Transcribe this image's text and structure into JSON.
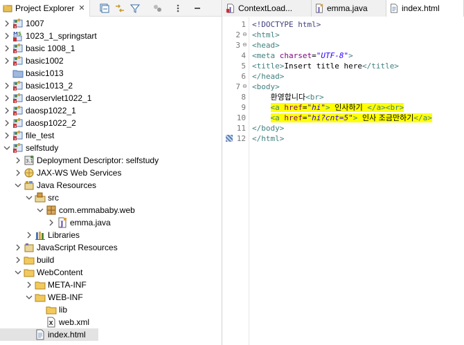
{
  "project_explorer": {
    "tab_label": "Project Explorer",
    "close_glyph": "✕",
    "toolbar": [
      "collapse-all-icon",
      "link-with-editor-icon",
      "filter-icon",
      "focus-icon",
      "view-menu-icon",
      "minimize-icon"
    ],
    "tree": [
      {
        "label": "1007",
        "icon": "web-project-icon",
        "depth": 0,
        "twisty": ">"
      },
      {
        "label": "1023_1_springstart",
        "icon": "maven-spring-project-icon",
        "depth": 0,
        "twisty": ">"
      },
      {
        "label": "basic 1008_1",
        "icon": "web-project-icon",
        "depth": 0,
        "twisty": ">"
      },
      {
        "label": "basic1002",
        "icon": "web-project-icon",
        "depth": 0,
        "twisty": ">"
      },
      {
        "label": "basic1013",
        "icon": "folder-project-icon",
        "depth": 0,
        "twisty": ""
      },
      {
        "label": "basic1013_2",
        "icon": "web-project-icon",
        "depth": 0,
        "twisty": ">"
      },
      {
        "label": "daoservlet1022_1",
        "icon": "web-project-icon",
        "depth": 0,
        "twisty": ">"
      },
      {
        "label": "daosp1022_1",
        "icon": "web-project-icon",
        "depth": 0,
        "twisty": ">"
      },
      {
        "label": "daosp1022_2",
        "icon": "web-project-icon",
        "depth": 0,
        "twisty": ">"
      },
      {
        "label": "file_test",
        "icon": "web-project-icon",
        "depth": 0,
        "twisty": ">"
      },
      {
        "label": "selfstudy",
        "icon": "web-project-icon",
        "depth": 0,
        "twisty": "v"
      },
      {
        "label": "Deployment Descriptor: selfstudy",
        "icon": "deployment-descriptor-icon",
        "depth": 1,
        "twisty": ">"
      },
      {
        "label": "JAX-WS Web Services",
        "icon": "web-services-icon",
        "depth": 1,
        "twisty": ">"
      },
      {
        "label": "Java Resources",
        "icon": "java-resources-icon",
        "depth": 1,
        "twisty": "v"
      },
      {
        "label": "src",
        "icon": "source-folder-icon",
        "depth": 2,
        "twisty": "v"
      },
      {
        "label": "com.emmababy.web",
        "icon": "package-icon",
        "depth": 3,
        "twisty": "v"
      },
      {
        "label": "emma.java",
        "icon": "java-file-icon",
        "depth": 4,
        "twisty": ">"
      },
      {
        "label": "Libraries",
        "icon": "libraries-icon",
        "depth": 2,
        "twisty": ">"
      },
      {
        "label": "JavaScript Resources",
        "icon": "javascript-resources-icon",
        "depth": 1,
        "twisty": ">"
      },
      {
        "label": "build",
        "icon": "folder-icon",
        "depth": 1,
        "twisty": ">"
      },
      {
        "label": "WebContent",
        "icon": "folder-icon",
        "depth": 1,
        "twisty": "v"
      },
      {
        "label": "META-INF",
        "icon": "folder-icon",
        "depth": 2,
        "twisty": ">"
      },
      {
        "label": "WEB-INF",
        "icon": "folder-icon",
        "depth": 2,
        "twisty": "v"
      },
      {
        "label": "lib",
        "icon": "folder-icon",
        "depth": 3,
        "twisty": ""
      },
      {
        "label": "web.xml",
        "icon": "xml-file-icon",
        "depth": 3,
        "twisty": ""
      },
      {
        "label": "index.html",
        "icon": "html-file-icon",
        "depth": 2,
        "twisty": "",
        "selected": true
      }
    ]
  },
  "editor": {
    "tabs": [
      {
        "label": "ContextLoad...",
        "icon": "java-class-icon",
        "active": false
      },
      {
        "label": "emma.java",
        "icon": "java-file-icon",
        "active": false
      },
      {
        "label": "index.html",
        "icon": "html-file-icon",
        "active": true
      }
    ],
    "lines": [
      {
        "n": "1",
        "fold": "",
        "highlight": false,
        "tokens": [
          [
            "doc",
            "<!DOCTYPE html>"
          ]
        ]
      },
      {
        "n": "2",
        "fold": "⊖",
        "highlight": false,
        "tokens": [
          [
            "tag",
            "<html>"
          ]
        ]
      },
      {
        "n": "3",
        "fold": "⊖",
        "highlight": false,
        "tokens": [
          [
            "tag",
            "<head>"
          ]
        ]
      },
      {
        "n": "4",
        "fold": "",
        "highlight": false,
        "tokens": [
          [
            "tag",
            "<meta "
          ],
          [
            "attr",
            "charset"
          ],
          [
            "txt",
            "="
          ],
          [
            "str",
            "\"UTF-8\""
          ],
          [
            "tag",
            ">"
          ]
        ]
      },
      {
        "n": "5",
        "fold": "",
        "highlight": false,
        "tokens": [
          [
            "tag",
            "<title>"
          ],
          [
            "txt",
            "Insert title here"
          ],
          [
            "tag",
            "</title>"
          ]
        ]
      },
      {
        "n": "6",
        "fold": "",
        "highlight": false,
        "tokens": [
          [
            "tag",
            "</head>"
          ]
        ]
      },
      {
        "n": "7",
        "fold": "⊖",
        "highlight": false,
        "tokens": [
          [
            "tag",
            "<body>"
          ]
        ]
      },
      {
        "n": "8",
        "fold": "",
        "highlight": false,
        "tokens": [
          [
            "txt",
            "    "
          ],
          [
            "kor",
            "환영합니다"
          ],
          [
            "tag",
            "<br>"
          ]
        ]
      },
      {
        "n": "9",
        "fold": "",
        "highlight": true,
        "tokens": [
          [
            "txt",
            "    "
          ],
          [
            "tag",
            "<a "
          ],
          [
            "attr",
            "href"
          ],
          [
            "txt",
            "="
          ],
          [
            "str",
            "\"hi\""
          ],
          [
            "tag",
            ">"
          ],
          [
            "txt",
            " "
          ],
          [
            "kor",
            "인사하기"
          ],
          [
            "txt",
            " "
          ],
          [
            "tag",
            "</a><br>"
          ]
        ]
      },
      {
        "n": "10",
        "fold": "",
        "highlight": true,
        "tokens": [
          [
            "txt",
            "    "
          ],
          [
            "tag",
            "<a "
          ],
          [
            "attr",
            "href"
          ],
          [
            "txt",
            "="
          ],
          [
            "str",
            "\"hi?cnt=5\""
          ],
          [
            "tag",
            ">"
          ],
          [
            "txt",
            " "
          ],
          [
            "kor",
            "인사 조금만하기"
          ],
          [
            "tag",
            "</a>"
          ]
        ]
      },
      {
        "n": "11",
        "fold": "",
        "highlight": false,
        "tokens": [
          [
            "tag",
            "</body>"
          ]
        ]
      },
      {
        "n": "12",
        "fold": "",
        "highlight": false,
        "tokens": [
          [
            "tag",
            "</html>"
          ]
        ],
        "marker": true
      }
    ]
  },
  "colors": {
    "accent": "#3f7f7f",
    "highlight": "#ffff00",
    "selection": "#e3e3e3"
  }
}
